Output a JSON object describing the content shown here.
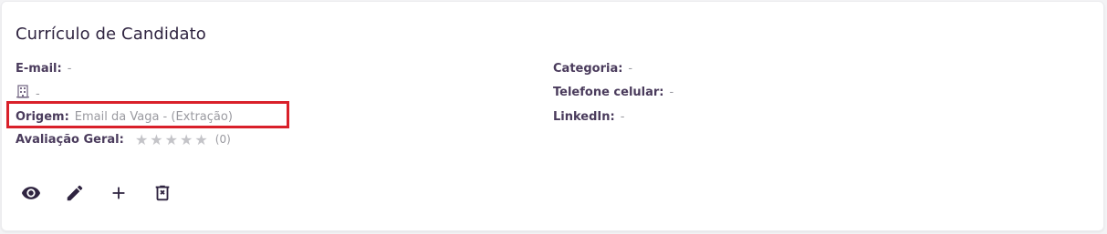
{
  "card": {
    "title": "Currículo de Candidato",
    "email": {
      "label": "E-mail:",
      "value": "-"
    },
    "company": {
      "icon": "building-icon",
      "value": "-"
    },
    "origin": {
      "label": "Origem:",
      "value": "Email da Vaga - (Extração)"
    },
    "rating": {
      "label": "Avaliação Geral:",
      "stars": 0,
      "max_stars": 5,
      "count": "(0)"
    },
    "category": {
      "label": "Categoria:",
      "value": "-"
    },
    "phone": {
      "label": "Telefone celular:",
      "value": "-"
    },
    "linkedin": {
      "label": "LinkedIn:",
      "value": "-"
    }
  },
  "actions": [
    {
      "name": "view-button",
      "icon": "eye-icon"
    },
    {
      "name": "edit-button",
      "icon": "pencil-icon"
    },
    {
      "name": "add-button",
      "icon": "plus-icon"
    },
    {
      "name": "delete-button",
      "icon": "trash-icon"
    }
  ],
  "colors": {
    "highlight": "#d9202a",
    "text": "#2f2440",
    "muted": "#9a9aa0"
  }
}
